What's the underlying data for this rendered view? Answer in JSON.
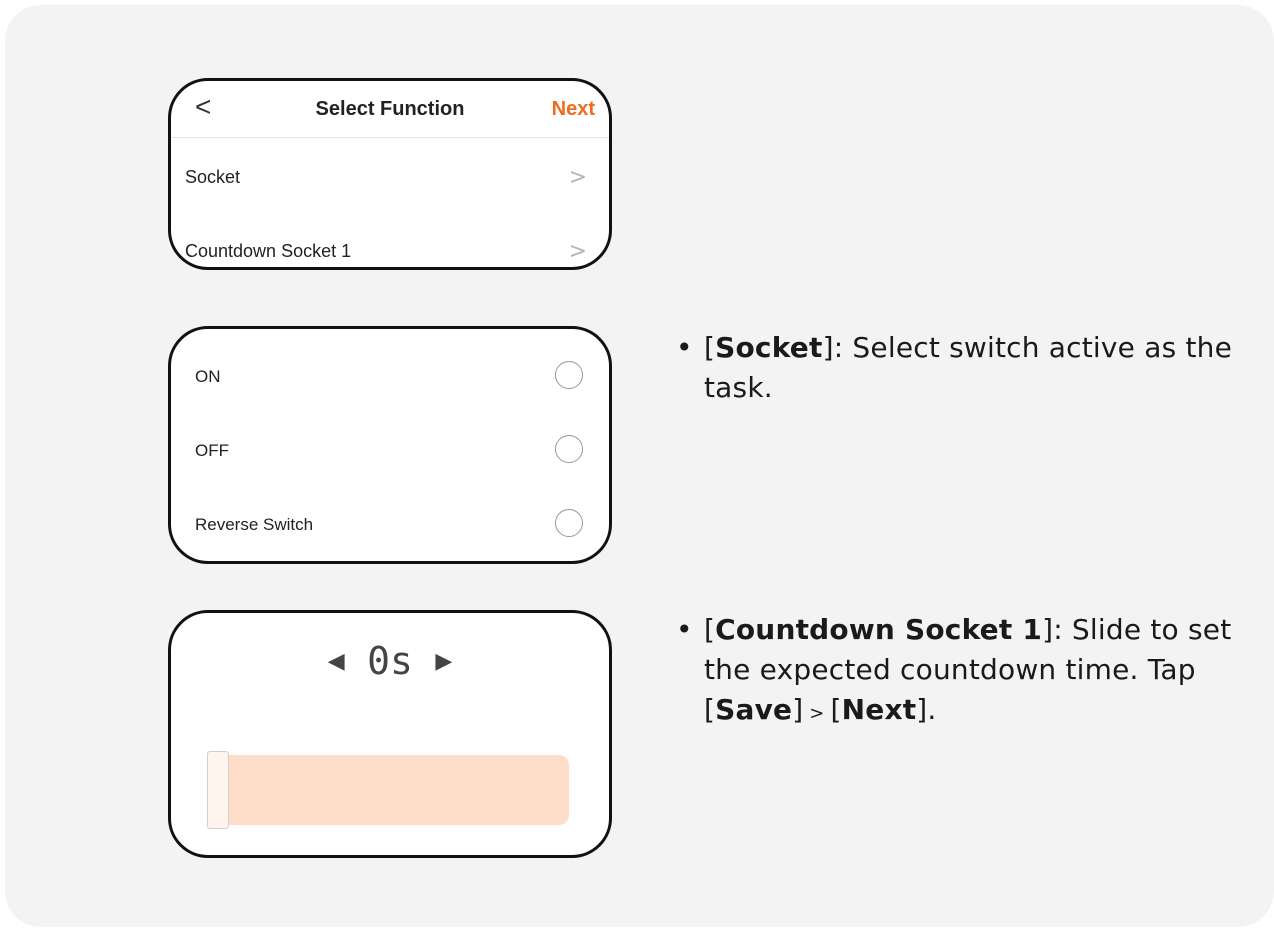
{
  "accent_color": "#ee6b1f",
  "panel1": {
    "back_icon": "chevron-left-icon",
    "back_glyph": "<",
    "title": "Select Function",
    "next_label": "Next",
    "rows": [
      {
        "label": "Socket",
        "chevron": ">"
      },
      {
        "label": "Countdown Socket 1",
        "chevron": ">"
      }
    ]
  },
  "panel2": {
    "options": [
      {
        "label": "ON"
      },
      {
        "label": "OFF"
      },
      {
        "label": "Reverse Switch"
      }
    ]
  },
  "panel3": {
    "picker_value": "0s",
    "left_arrow": "◀",
    "right_arrow": "▶",
    "slider_value": 0
  },
  "descriptions": [
    {
      "bullet": "•",
      "bracket_open": "[",
      "term": "Socket",
      "bracket_close": "]",
      "text": ": Select switch active as the task."
    },
    {
      "bullet": "•",
      "bracket_open": "[",
      "term": "Countdown Socket 1",
      "bracket_close": "]",
      "text": ": Slide to set the expected countdown time. Tap ",
      "save_open": "[",
      "save_term": "Save",
      "save_close": "]",
      "gt": " > ",
      "next_open": "[",
      "next_term": "Next",
      "next_close": "]",
      "end": "."
    }
  ]
}
